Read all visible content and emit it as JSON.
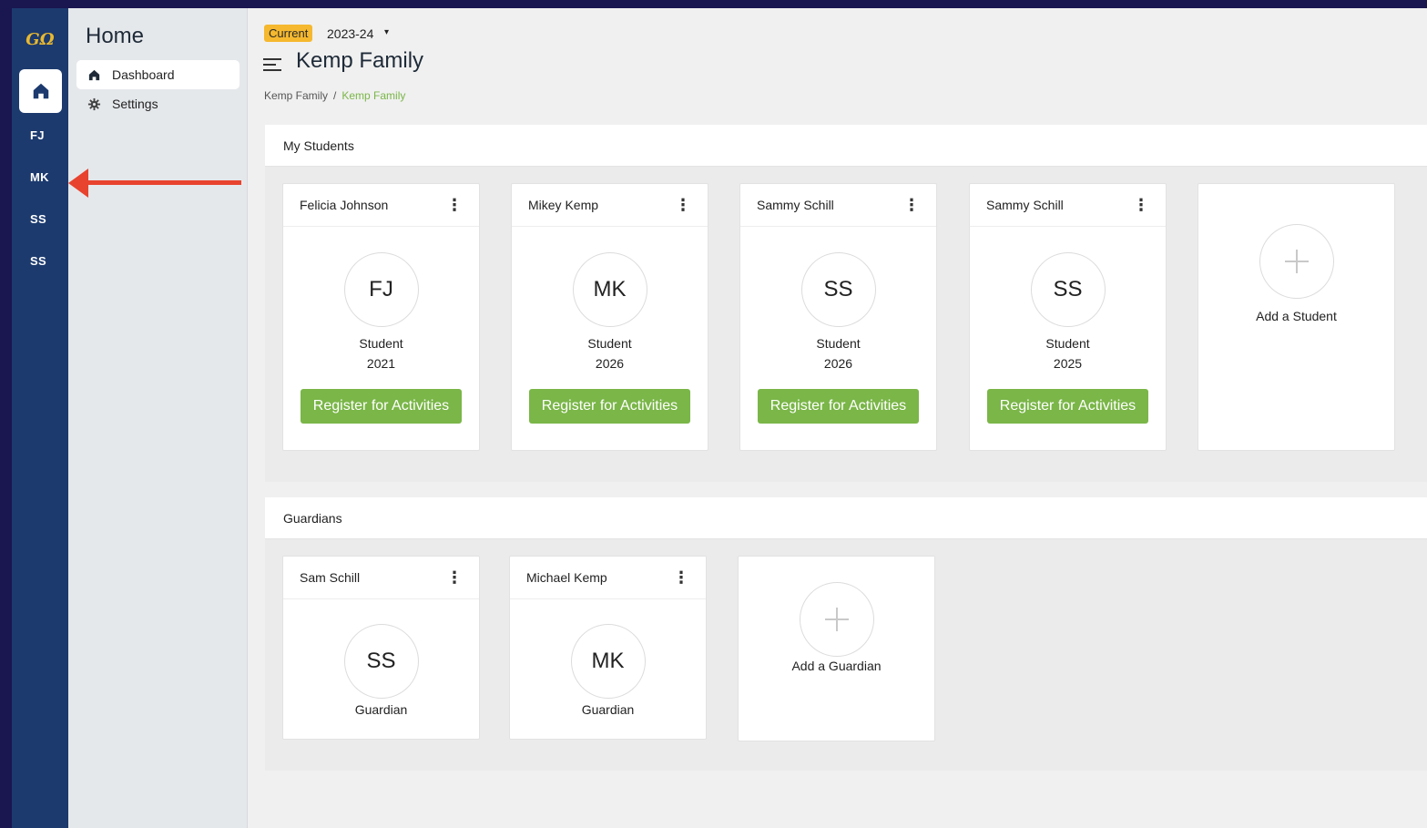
{
  "rail": {
    "logo_text": "GΩ",
    "items": [
      {
        "label": "FJ"
      },
      {
        "label": "MK"
      },
      {
        "label": "SS"
      },
      {
        "label": "SS"
      }
    ]
  },
  "sidebar": {
    "title": "Home",
    "items": [
      {
        "label": "Dashboard",
        "icon": "home-icon",
        "active": true
      },
      {
        "label": "Settings",
        "icon": "gear-icon",
        "active": false
      }
    ]
  },
  "header": {
    "term_badge": "Current",
    "term_year": "2023-24",
    "term_caret": "▾",
    "title": "Kemp Family",
    "breadcrumb": {
      "root": "Kemp Family",
      "separator": "/",
      "current": "Kemp Family"
    }
  },
  "students": {
    "section_title": "My Students",
    "cards": [
      {
        "name": "Felicia Johnson",
        "initials": "FJ",
        "role": "Student",
        "year": "2021",
        "button": "Register for Activities"
      },
      {
        "name": "Mikey Kemp",
        "initials": "MK",
        "role": "Student",
        "year": "2026",
        "button": "Register for Activities"
      },
      {
        "name": "Sammy Schill",
        "initials": "SS",
        "role": "Student",
        "year": "2026",
        "button": "Register for Activities"
      },
      {
        "name": "Sammy Schill",
        "initials": "SS",
        "role": "Student",
        "year": "2025",
        "button": "Register for Activities"
      }
    ],
    "add_label": "Add a Student"
  },
  "guardians": {
    "section_title": "Guardians",
    "cards": [
      {
        "name": "Sam Schill",
        "initials": "SS",
        "role": "Guardian"
      },
      {
        "name": "Michael Kemp",
        "initials": "MK",
        "role": "Guardian"
      }
    ],
    "add_label": "Add a Guardian"
  },
  "kebab_glyph": "⋮",
  "colors": {
    "rail_bg": "#1c3a6e",
    "accent_green": "#7ab648",
    "badge_yellow": "#f5b82e",
    "annotation_red": "#e8432e",
    "outer_frame": "#1a1650"
  }
}
